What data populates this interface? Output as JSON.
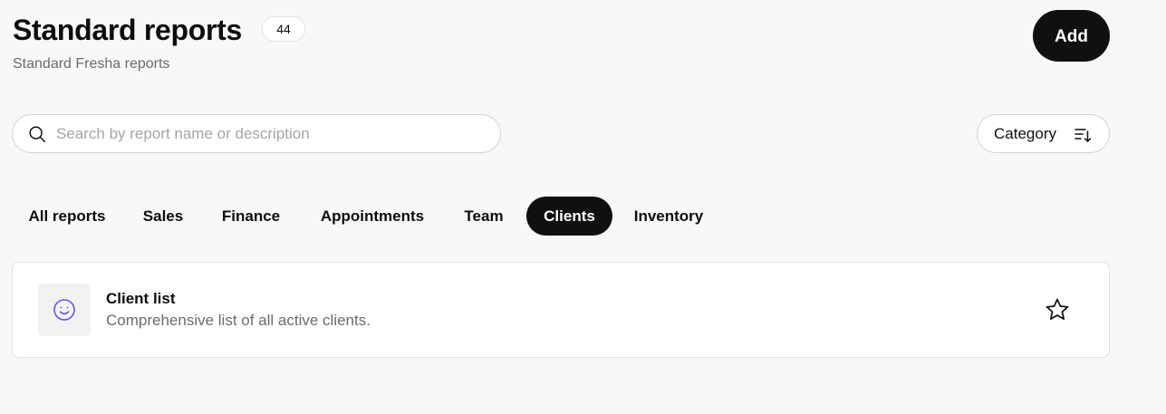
{
  "header": {
    "title": "Standard reports",
    "count": "44",
    "subtitle": "Standard Fresha reports",
    "add_label": "Add"
  },
  "search": {
    "placeholder": "Search by report name or description",
    "value": ""
  },
  "filter": {
    "category_label": "Category"
  },
  "tabs": [
    {
      "label": "All reports",
      "active": false
    },
    {
      "label": "Sales",
      "active": false
    },
    {
      "label": "Finance",
      "active": false
    },
    {
      "label": "Appointments",
      "active": false
    },
    {
      "label": "Team",
      "active": false
    },
    {
      "label": "Clients",
      "active": true
    },
    {
      "label": "Inventory",
      "active": false
    }
  ],
  "reports": [
    {
      "title": "Client list",
      "description": "Comprehensive list of all active clients.",
      "icon": "smile-icon",
      "favorited": false
    }
  ],
  "colors": {
    "accent": "#6950f3",
    "dark": "#101010",
    "muted_text": "#6b6b6b"
  }
}
